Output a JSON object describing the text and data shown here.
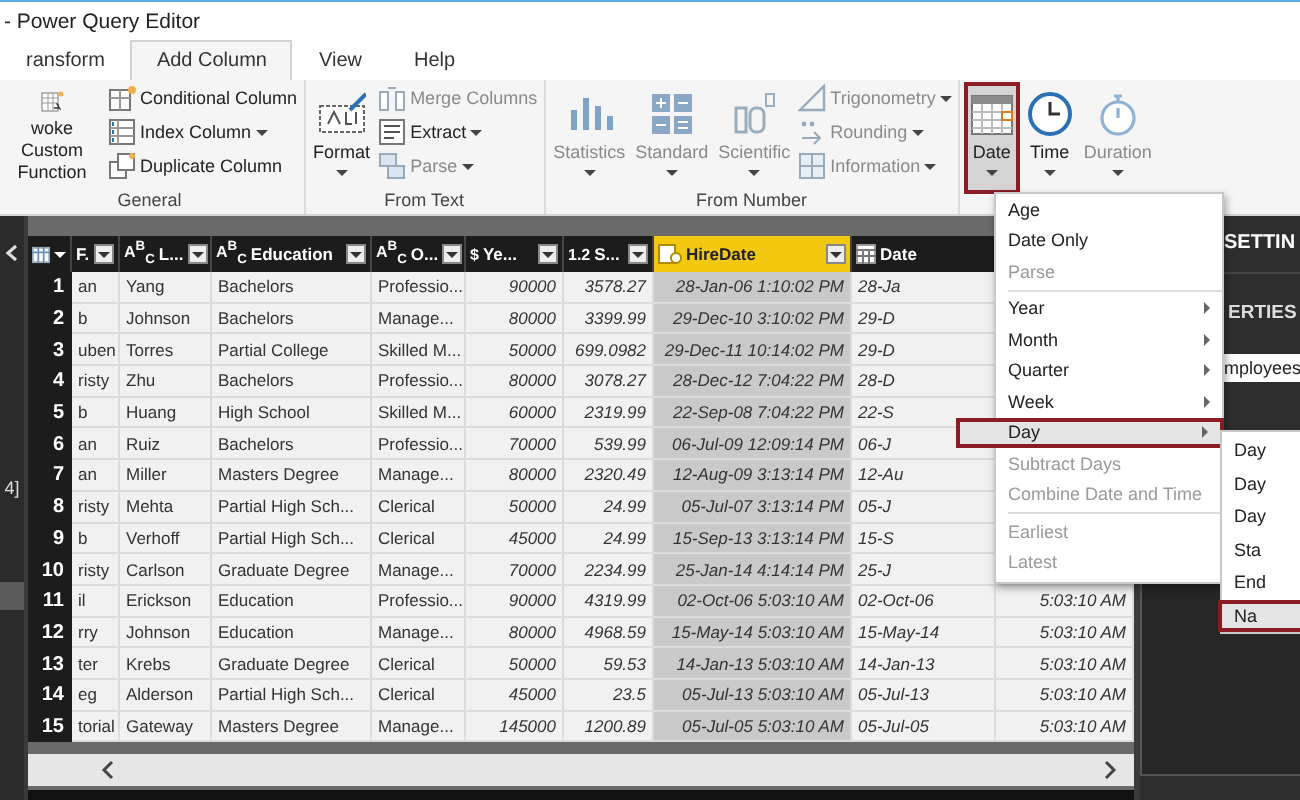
{
  "window": {
    "title": "- Power Query Editor"
  },
  "tabs": [
    {
      "label": "ransform",
      "selected": false
    },
    {
      "label": "Add Column",
      "selected": true
    },
    {
      "label": "View",
      "selected": false
    },
    {
      "label": "Help",
      "selected": false
    }
  ],
  "ribbon": {
    "groups": [
      {
        "label": "General",
        "large": [
          {
            "label": "woke Custom Function",
            "dropdown": false,
            "disabled": false,
            "selected": false
          }
        ],
        "small": [
          {
            "label": "Conditional Column",
            "dropdown": false,
            "disabled": false
          },
          {
            "label": "Index Column",
            "dropdown": true,
            "disabled": false
          },
          {
            "label": "Duplicate Column",
            "dropdown": false,
            "disabled": false
          }
        ]
      },
      {
        "label": "From Text",
        "large": [
          {
            "label": "Format",
            "dropdown": true,
            "disabled": false,
            "selected": false
          }
        ],
        "small": [
          {
            "label": "Merge Columns",
            "dropdown": false,
            "disabled": true
          },
          {
            "label": "Extract",
            "dropdown": true,
            "disabled": false
          },
          {
            "label": "Parse",
            "dropdown": true,
            "disabled": true
          }
        ]
      },
      {
        "label": "From Number",
        "large": [
          {
            "label": "Statistics",
            "dropdown": true,
            "disabled": true,
            "selected": false
          },
          {
            "label": "Standard",
            "dropdown": true,
            "disabled": true,
            "selected": false
          },
          {
            "label": "Scientific",
            "dropdown": true,
            "disabled": true,
            "selected": false
          }
        ],
        "small": [
          {
            "label": "Trigonometry",
            "dropdown": true,
            "disabled": true
          },
          {
            "label": "Rounding",
            "dropdown": true,
            "disabled": true
          },
          {
            "label": "Information",
            "dropdown": true,
            "disabled": true
          }
        ]
      },
      {
        "large": [
          {
            "label": "Date",
            "dropdown": true,
            "disabled": false,
            "selected": true
          },
          {
            "label": "Time",
            "dropdown": true,
            "disabled": false,
            "selected": false
          },
          {
            "label": "Duration",
            "dropdown": true,
            "disabled": true,
            "selected": false
          }
        ]
      }
    ]
  },
  "queries_pane": {
    "item": "4]"
  },
  "table": {
    "columns": [
      {
        "label": "F.",
        "selected": false
      },
      {
        "label": "L...",
        "type_glyph": "A$^{B}$$_{C}$",
        "selected": false
      },
      {
        "label": "Education",
        "type_glyph": "A$^{B}$$_{C}$",
        "selected": false
      },
      {
        "label": "O...",
        "type_glyph": "A$^{B}$$_{C}$",
        "selected": false
      },
      {
        "label": "Ye...",
        "type_glyph": "$",
        "selected": false
      },
      {
        "label": "S...",
        "type_glyph": "1.2",
        "selected": false
      },
      {
        "label": "HireDate",
        "selected": true
      },
      {
        "label": "Date",
        "selected": false
      }
    ],
    "rows": [
      {
        "num": "1",
        "cells": [
          "an",
          "Yang",
          "Bachelors",
          "Professio...",
          "90000",
          "3578.27",
          "28-Jan-06 1:10:02 PM",
          "28-Ja"
        ]
      },
      {
        "num": "2",
        "cells": [
          "b",
          "Johnson",
          "Bachelors",
          "Manage...",
          "80000",
          "3399.99",
          "29-Dec-10 3:10:02 PM",
          "29-D"
        ]
      },
      {
        "num": "3",
        "cells": [
          "uben",
          "Torres",
          "Partial College",
          "Skilled M...",
          "50000",
          "699.0982",
          "29-Dec-11 10:14:02 PM",
          "29-D"
        ]
      },
      {
        "num": "4",
        "cells": [
          "risty",
          "Zhu",
          "Bachelors",
          "Professio...",
          "80000",
          "3078.27",
          "28-Dec-12 7:04:22 PM",
          "28-D"
        ]
      },
      {
        "num": "5",
        "cells": [
          "b",
          "Huang",
          "High School",
          "Skilled M...",
          "60000",
          "2319.99",
          "22-Sep-08 7:04:22 PM",
          "22-S"
        ]
      },
      {
        "num": "6",
        "cells": [
          "an",
          "Ruiz",
          "Bachelors",
          "Professio...",
          "70000",
          "539.99",
          "06-Jul-09 12:09:14 PM",
          "06-J"
        ]
      },
      {
        "num": "7",
        "cells": [
          "an",
          "Miller",
          "Masters Degree",
          "Manage...",
          "80000",
          "2320.49",
          "12-Aug-09 3:13:14 PM",
          "12-Au"
        ]
      },
      {
        "num": "8",
        "cells": [
          "risty",
          "Mehta",
          "Partial High Sch...",
          "Clerical",
          "50000",
          "24.99",
          "05-Jul-07 3:13:14 PM",
          "05-J"
        ]
      },
      {
        "num": "9",
        "cells": [
          "b",
          "Verhoff",
          "Partial High Sch...",
          "Clerical",
          "45000",
          "24.99",
          "15-Sep-13 3:13:14 PM",
          "15-S"
        ]
      },
      {
        "num": "10",
        "cells": [
          "risty",
          "Carlson",
          "Graduate Degree",
          "Manage...",
          "70000",
          "2234.99",
          "25-Jan-14 4:14:14 PM",
          "25-J"
        ]
      },
      {
        "num": "11",
        "cells": [
          "il",
          "Erickson",
          "Education",
          "Professio...",
          "90000",
          "4319.99",
          "02-Oct-06 5:03:10 AM",
          "02-Oct-06"
        ],
        "column_10": "5:03:10 AM"
      },
      {
        "num": "12",
        "cells": [
          "rry",
          "Johnson",
          "Education",
          "Manage...",
          "80000",
          "4968.59",
          "15-May-14 5:03:10 AM",
          "15-May-14"
        ],
        "column_10": "5:03:10 AM"
      },
      {
        "num": "13",
        "cells": [
          "ter",
          "Krebs",
          "Graduate Degree",
          "Clerical",
          "50000",
          "59.53",
          "14-Jan-13 5:03:10 AM",
          "14-Jan-13"
        ],
        "column_10": "5:03:10 AM"
      },
      {
        "num": "14",
        "cells": [
          "eg",
          "Alderson",
          "Partial High Sch...",
          "Clerical",
          "45000",
          "23.5",
          "05-Jul-13 5:03:10 AM",
          "05-Jul-13"
        ],
        "column_10": "5:03:10 AM"
      },
      {
        "num": "15",
        "cells": [
          "torial",
          "Gateway",
          "Masters Degree",
          "Manage...",
          "145000",
          "1200.89",
          "05-Jul-05 5:03:10 AM",
          "05-Jul-05"
        ],
        "column_10": "5:03:10 AM"
      }
    ]
  },
  "settings_pane": {
    "title": "SETTIN",
    "section": "ERTIES",
    "name_value": "mployees"
  },
  "date_menu": {
    "items": [
      {
        "kind": "item",
        "label": "Age",
        "disabled": false,
        "submenu": false,
        "selected": false
      },
      {
        "kind": "item",
        "label": "Date Only",
        "disabled": false,
        "submenu": false,
        "selected": false
      },
      {
        "kind": "item",
        "label": "Parse",
        "disabled": true,
        "submenu": false,
        "selected": false
      },
      {
        "kind": "separator"
      },
      {
        "kind": "item",
        "label": "Year",
        "disabled": false,
        "submenu": true,
        "selected": false
      },
      {
        "kind": "item",
        "label": "Month",
        "disabled": false,
        "submenu": true,
        "selected": false
      },
      {
        "kind": "item",
        "label": "Quarter",
        "disabled": false,
        "submenu": true,
        "selected": false
      },
      {
        "kind": "item",
        "label": "Week",
        "disabled": false,
        "submenu": true,
        "selected": false
      },
      {
        "kind": "item",
        "label": "Day",
        "disabled": false,
        "submenu": true,
        "selected": true
      },
      {
        "kind": "item",
        "label": "Subtract Days",
        "disabled": true,
        "submenu": false,
        "selected": false
      },
      {
        "kind": "item",
        "label": "Combine Date and Time",
        "disabled": true,
        "submenu": false,
        "selected": false
      },
      {
        "kind": "separator"
      },
      {
        "kind": "item",
        "label": "Earliest",
        "disabled": true,
        "submenu": false,
        "selected": false
      },
      {
        "kind": "item",
        "label": "Latest",
        "disabled": true,
        "submenu": false,
        "selected": false
      }
    ]
  },
  "day_submenu": {
    "items": [
      {
        "label": "Day",
        "selected": false
      },
      {
        "label": "Day",
        "selected": false
      },
      {
        "label": "Day",
        "selected": false
      },
      {
        "label": "Sta",
        "selected": false
      },
      {
        "label": "End",
        "selected": false
      },
      {
        "label": "Na",
        "selected": true
      }
    ]
  }
}
